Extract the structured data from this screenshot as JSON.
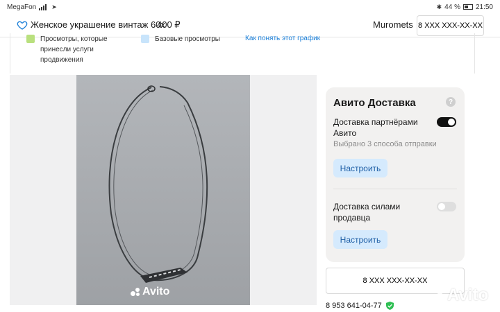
{
  "status_bar": {
    "carrier": "MegaFon",
    "battery": "44 %",
    "time": "21:50"
  },
  "header": {
    "title": "Женское украшение винтаж 60х",
    "price": "400 ₽",
    "seller": "Muromets",
    "phone_button": "8 XXX XXX-XX-XX"
  },
  "legend": {
    "items": [
      {
        "label": "Просмотры, которые принесли услуги продвижения",
        "color": "#b9e07e"
      },
      {
        "label": "Базовые просмотры",
        "color": "#c8e4fb"
      }
    ],
    "link": "Как понять этот график"
  },
  "gallery": {
    "watermark": "Avito"
  },
  "delivery": {
    "title": "Авито Доставка",
    "help_icon": "?",
    "options": [
      {
        "label": "Доставка партнёрами Авито",
        "sub": "Выбрано 3 способа отправки",
        "enabled": true,
        "button": "Настроить"
      },
      {
        "label": "Доставка силами продавца",
        "sub": "",
        "enabled": false,
        "button": "Настроить"
      }
    ]
  },
  "contact": {
    "phone_button": "8 XXX XXX-XX-XX",
    "verified_phone": "8 953 641-04-77"
  },
  "watermark": "Avito",
  "colors": {
    "accent_link": "#1b7fd8",
    "button_bg": "#d5eafd",
    "verified": "#2fbf54"
  }
}
